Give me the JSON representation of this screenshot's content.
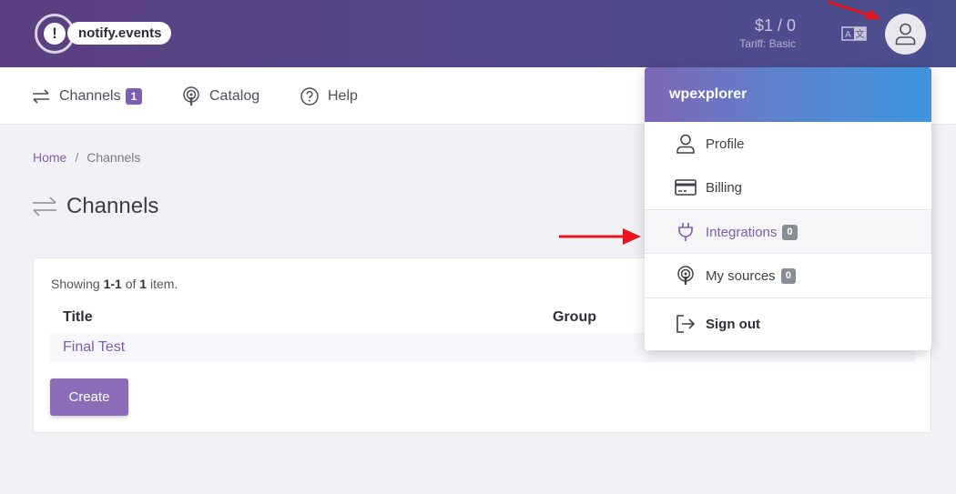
{
  "header": {
    "logo_symbol": "!",
    "logo_text": "notify.events",
    "balance_amount": "$1 / 0",
    "tariff": "Tariff: Basic",
    "translate_icon": "translate-icon",
    "user_icon": "user-icon"
  },
  "nav": {
    "items": [
      {
        "label": "Channels",
        "badge": "1",
        "icon": "arrows-exchange-icon"
      },
      {
        "label": "Catalog",
        "icon": "podcast-icon"
      },
      {
        "label": "Help",
        "icon": "question-circle-icon"
      }
    ]
  },
  "breadcrumb": {
    "home": "Home",
    "separator": "/",
    "current": "Channels"
  },
  "page": {
    "title": "Channels",
    "title_icon": "arrows-exchange-icon"
  },
  "table": {
    "summary_prefix": "Showing ",
    "summary_range": "1-1",
    "summary_of": " of ",
    "summary_total": "1",
    "summary_suffix": " item.",
    "columns": [
      "Title",
      "Group"
    ],
    "rows": [
      {
        "title": "Final Test"
      }
    ],
    "create_label": "Create"
  },
  "dropdown": {
    "username": "wpexplorer",
    "items": [
      {
        "label": "Profile",
        "icon": "user-icon"
      },
      {
        "label": "Billing",
        "icon": "credit-card-icon"
      },
      {
        "label": "Integrations",
        "badge": "0",
        "icon": "plug-icon"
      },
      {
        "label": "My sources",
        "badge": "0",
        "icon": "podcast-icon"
      },
      {
        "label": "Sign out",
        "icon": "sign-out-icon"
      }
    ]
  },
  "colors": {
    "header_start": "#5b3f80",
    "header_end": "#4a4f8e",
    "accent": "#7c5fb0",
    "annotation_arrow": "#e8141b"
  }
}
